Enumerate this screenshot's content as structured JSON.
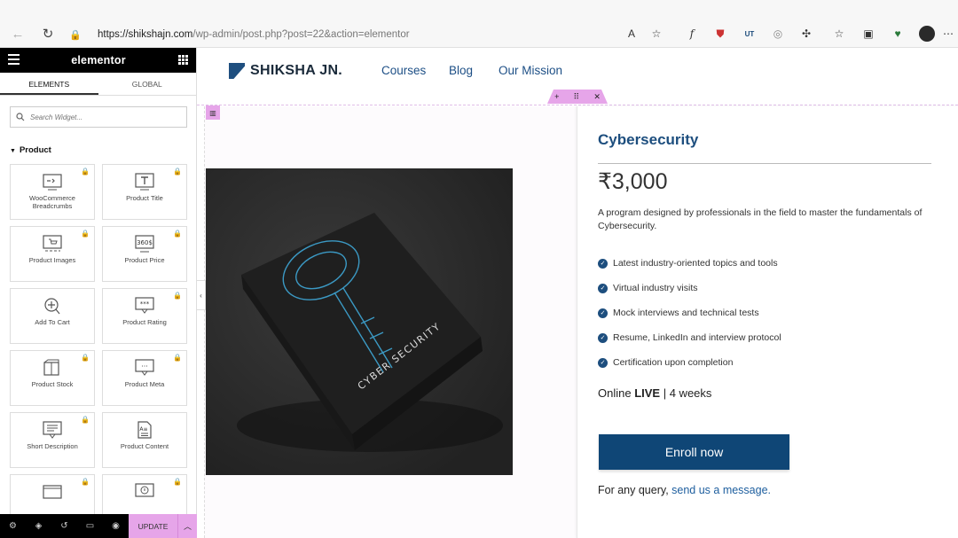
{
  "browser": {
    "url_host": "https://shikshajn.com",
    "url_path": "/wp-admin/post.php?post=22&action=elementor"
  },
  "editor": {
    "brand": "elementor",
    "tabs": [
      {
        "label": "ELEMENTS",
        "active": true
      },
      {
        "label": "GLOBAL",
        "active": false
      }
    ],
    "search_placeholder": "Search Widget...",
    "category": "Product",
    "widgets": [
      {
        "label": "WooCommerce Breadcrumbs",
        "icon": "breadcrumbs-icon"
      },
      {
        "label": "Product Title",
        "icon": "title-icon"
      },
      {
        "label": "Product Images",
        "icon": "images-icon"
      },
      {
        "label": "Product Price",
        "icon": "price-icon"
      },
      {
        "label": "Add To Cart",
        "icon": "add-to-cart-icon"
      },
      {
        "label": "Product Rating",
        "icon": "rating-icon"
      },
      {
        "label": "Product Stock",
        "icon": "stock-icon"
      },
      {
        "label": "Product Meta",
        "icon": "meta-icon"
      },
      {
        "label": "Short Description",
        "icon": "short-description-icon"
      },
      {
        "label": "Product Content",
        "icon": "content-icon"
      },
      {
        "label": "",
        "icon": "widget-icon"
      },
      {
        "label": "",
        "icon": "widget-icon"
      }
    ],
    "update_label": "UPDATE"
  },
  "site": {
    "logo": "SHIKSHA JN.",
    "nav": [
      "Courses",
      "Blog",
      "Our Mission"
    ]
  },
  "product": {
    "title": "Cybersecurity",
    "price": "₹3,000",
    "description": "A program designed by professionals in the field to master the fundamentals of Cybersecurity.",
    "features": [
      "Latest industry-oriented topics and tools",
      "Virtual industry visits",
      "Mock interviews and technical tests",
      "Resume, LinkedIn and interview protocol",
      "Certification upon completion"
    ],
    "mode_prefix": "Online ",
    "mode_live": "LIVE",
    "mode_suffix": " | 4 weeks",
    "enroll_label": "Enroll now",
    "query_prefix": "For any query, ",
    "query_link": "send us a message.",
    "image_text": "CYBER SECURITY"
  },
  "colors": {
    "brand_blue": "#1d4e7e",
    "button_blue": "#0f4676",
    "elementor_pink": "#e6a5e9"
  }
}
